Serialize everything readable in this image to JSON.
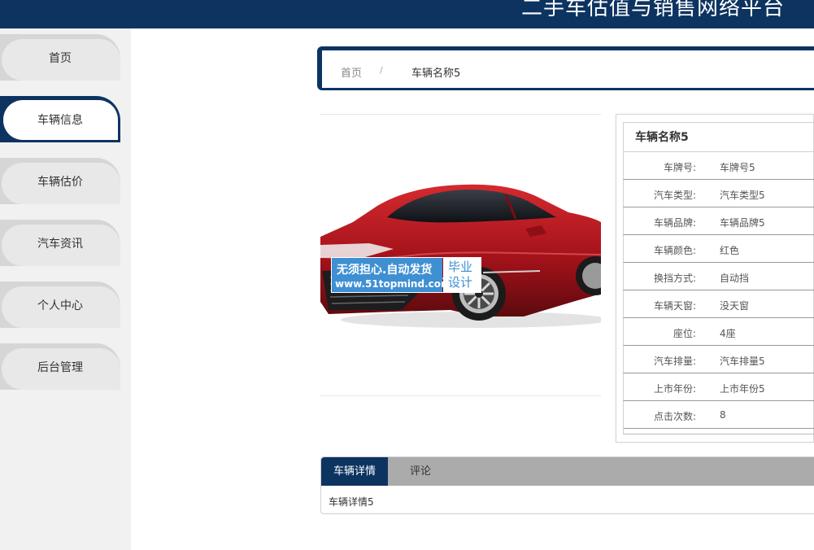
{
  "header": {
    "title": "二手车估值与销售网络平台"
  },
  "sidebar": {
    "items": [
      {
        "label": "首页"
      },
      {
        "label": "车辆信息"
      },
      {
        "label": "车辆估价"
      },
      {
        "label": "汽车资讯"
      },
      {
        "label": "个人中心"
      },
      {
        "label": "后台管理"
      }
    ],
    "active_index": 1
  },
  "breadcrumb": {
    "home": "首页",
    "separator": "/",
    "current": "车辆名称5"
  },
  "watermark": {
    "line1": "无须担心.自动发货",
    "line2": "www.51topmind.com",
    "side1": "毕业",
    "side2": "设计"
  },
  "vehicle": {
    "name": "车辆名称5",
    "fields": [
      {
        "key": "车牌号:",
        "value": "车牌号5"
      },
      {
        "key": "汽车类型:",
        "value": "汽车类型5"
      },
      {
        "key": "车辆品牌:",
        "value": "车辆品牌5"
      },
      {
        "key": "车辆颜色:",
        "value": "红色"
      },
      {
        "key": "换挡方式:",
        "value": "自动挡"
      },
      {
        "key": "车辆天窗:",
        "value": "没天窗"
      },
      {
        "key": "座位:",
        "value": "4座"
      },
      {
        "key": "汽车排量:",
        "value": "汽车排量5"
      },
      {
        "key": "上市年份:",
        "value": "上市年份5"
      },
      {
        "key": "点击次数:",
        "value": "8"
      }
    ]
  },
  "tabs": {
    "items": [
      {
        "label": "车辆详情"
      },
      {
        "label": "评论"
      }
    ],
    "content": "车辆详情5"
  },
  "colors": {
    "primary": "#0d3461",
    "sidebar_bg": "#f1f1f1",
    "tab_bar": "#ababab",
    "watermark_blue": "#3f8fd3",
    "car_red": "#b3141a"
  }
}
